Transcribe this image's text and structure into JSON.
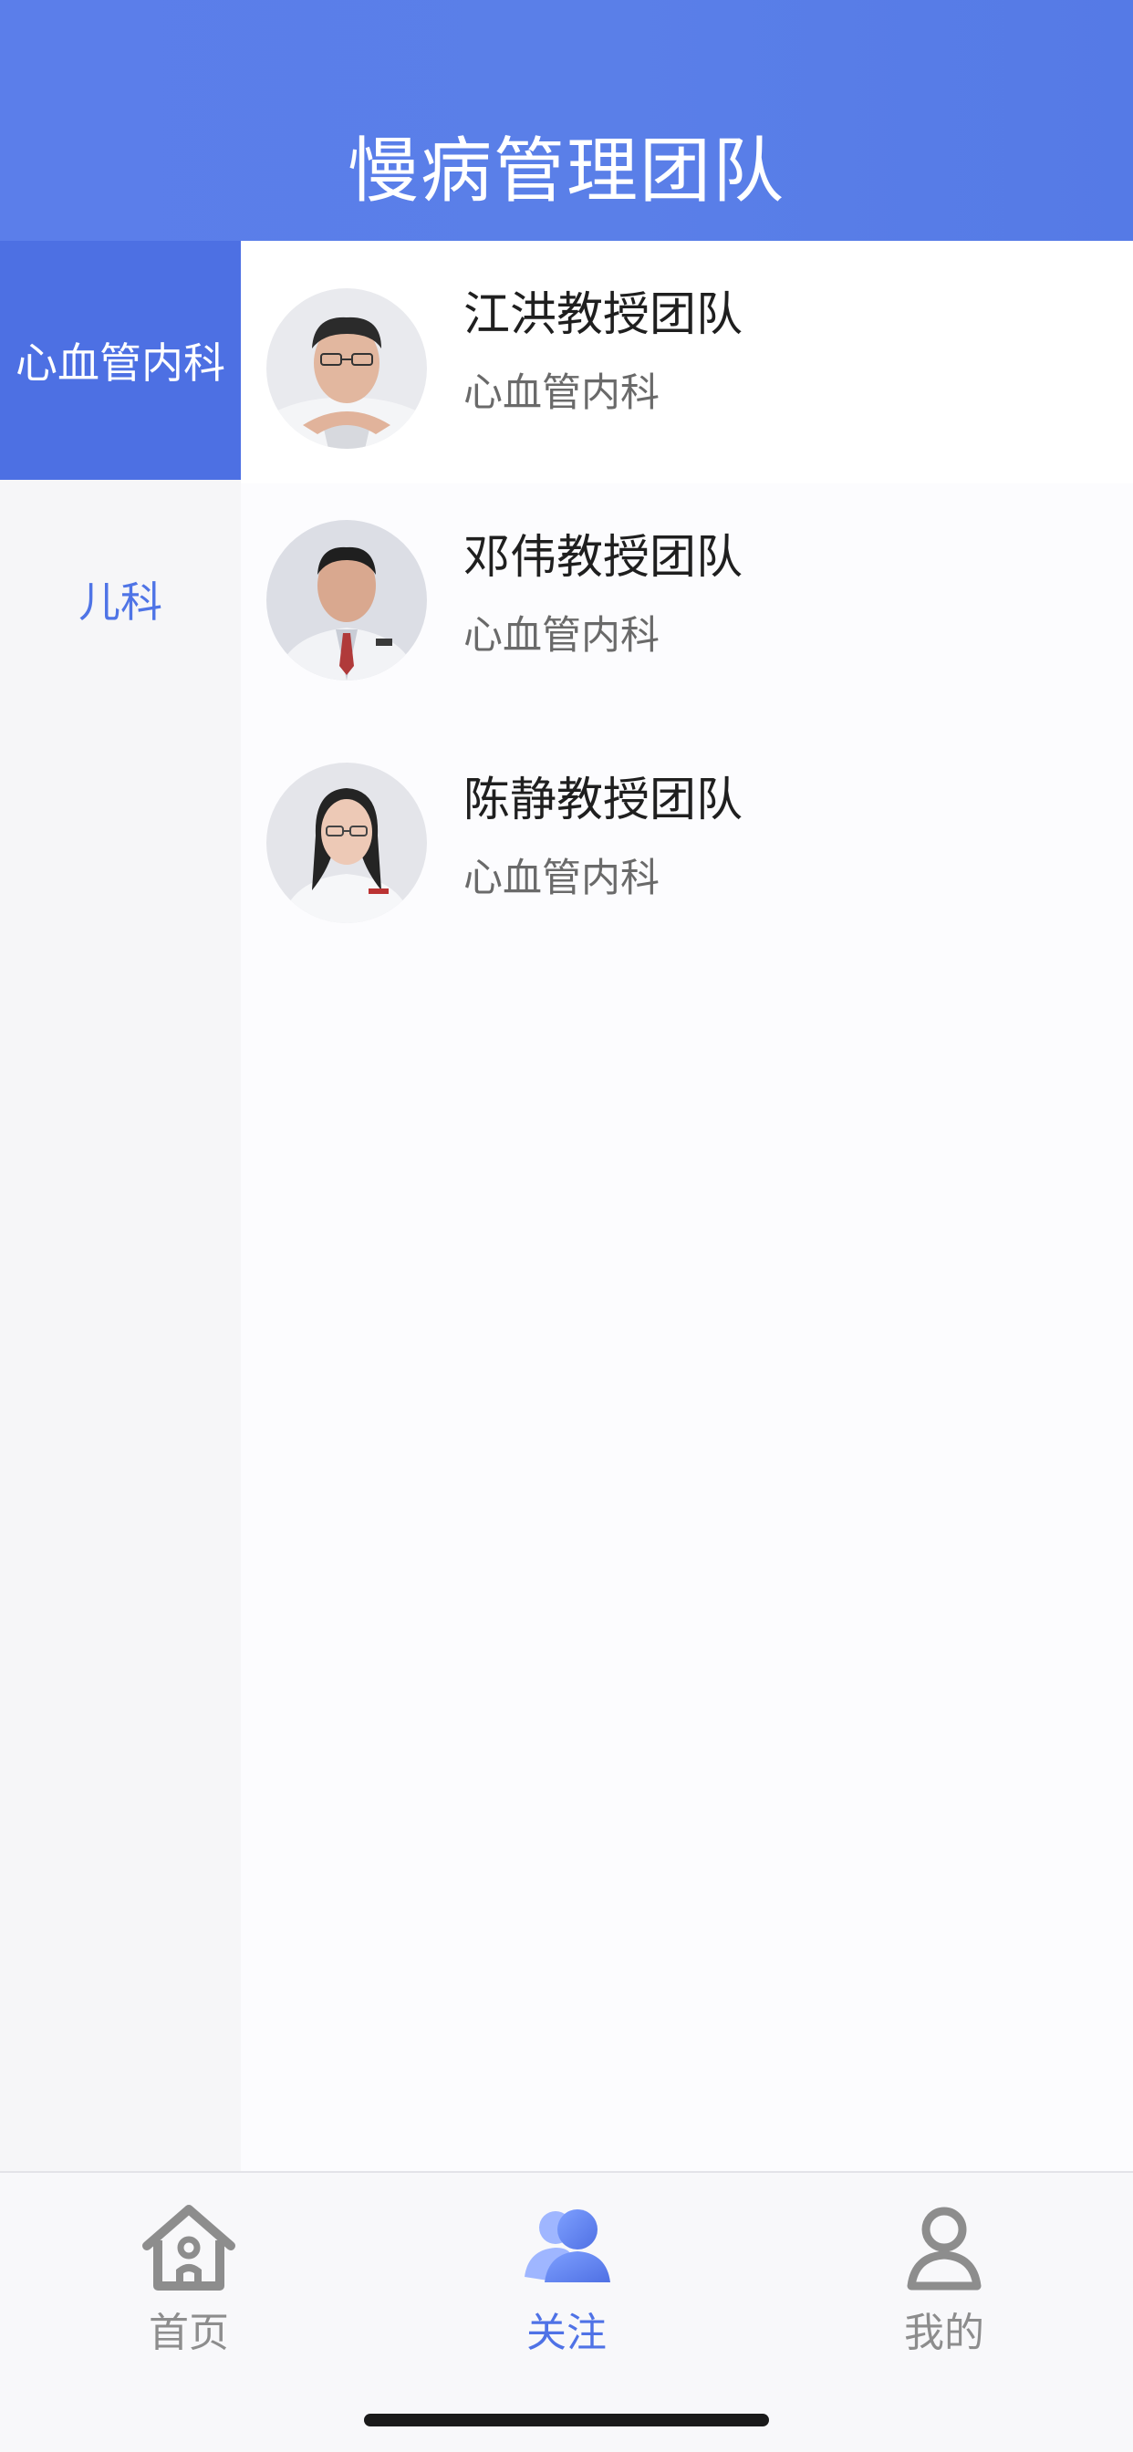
{
  "header": {
    "title": "慢病管理团队"
  },
  "sidebar": {
    "items": [
      {
        "label": "心血管内科",
        "active": true
      },
      {
        "label": "儿科",
        "active": false
      }
    ]
  },
  "teams": [
    {
      "name": "江洪教授团队",
      "department": "心血管内科"
    },
    {
      "name": "邓伟教授团队",
      "department": "心血管内科"
    },
    {
      "name": "陈静教授团队",
      "department": "心血管内科"
    }
  ],
  "tabbar": {
    "tabs": [
      {
        "label": "首页",
        "icon": "home-icon",
        "active": false
      },
      {
        "label": "关注",
        "icon": "follow-people-icon",
        "active": true
      },
      {
        "label": "我的",
        "icon": "person-icon",
        "active": false
      }
    ]
  },
  "colors": {
    "header_bg": "#5b7eea",
    "accent": "#4d70e3",
    "inactive_tab": "#8d8d8d"
  }
}
